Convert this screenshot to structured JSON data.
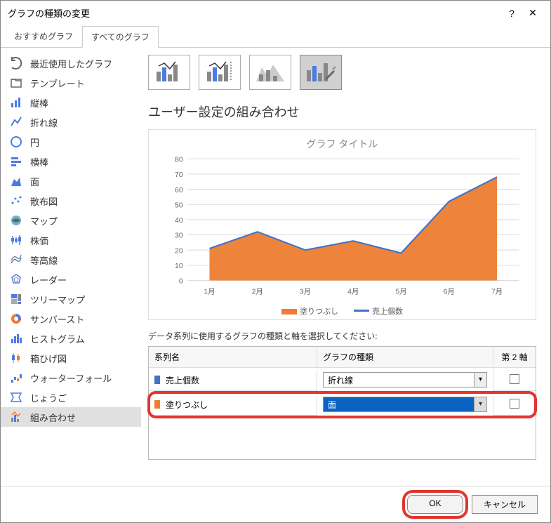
{
  "dialog": {
    "title": "グラフの種類の変更"
  },
  "tabs": {
    "recommended": "おすすめグラフ",
    "all": "すべてのグラフ"
  },
  "sidebar": {
    "items": [
      {
        "label": "最近使用したグラフ"
      },
      {
        "label": "テンプレート"
      },
      {
        "label": "縦棒"
      },
      {
        "label": "折れ線"
      },
      {
        "label": "円"
      },
      {
        "label": "横棒"
      },
      {
        "label": "面"
      },
      {
        "label": "散布図"
      },
      {
        "label": "マップ"
      },
      {
        "label": "株価"
      },
      {
        "label": "等高線"
      },
      {
        "label": "レーダー"
      },
      {
        "label": "ツリーマップ"
      },
      {
        "label": "サンバースト"
      },
      {
        "label": "ヒストグラム"
      },
      {
        "label": "箱ひげ図"
      },
      {
        "label": "ウォーターフォール"
      },
      {
        "label": "じょうご"
      },
      {
        "label": "組み合わせ"
      }
    ],
    "selected_index": 18
  },
  "section_title": "ユーザー設定の組み合わせ",
  "chart_data": {
    "type": "area+line",
    "title": "グラフ タイトル",
    "categories": [
      "1月",
      "2月",
      "3月",
      "4月",
      "5月",
      "6月",
      "7月"
    ],
    "series": [
      {
        "name": "塗りつぶし",
        "type": "area",
        "color": "#ED7D31",
        "values": [
          21,
          32,
          20,
          26,
          18,
          52,
          68
        ]
      },
      {
        "name": "売上個数",
        "type": "line",
        "color": "#4472C4",
        "values": [
          21,
          32,
          20,
          26,
          18,
          52,
          68
        ]
      }
    ],
    "y_ticks": [
      0,
      10,
      20,
      30,
      40,
      50,
      60,
      70,
      80
    ],
    "ylim": [
      0,
      80
    ]
  },
  "legend": {
    "area": "塗りつぶし",
    "line": "売上個数"
  },
  "instruction": "データ系列に使用するグラフの種類と軸を選択してください:",
  "grid": {
    "headers": {
      "name": "系列名",
      "type": "グラフの種類",
      "axis": "第 2 軸"
    },
    "rows": [
      {
        "color": "#4472C4",
        "name": "売上個数",
        "type": "折れ線",
        "axis": false,
        "highlighted": false,
        "selected": false
      },
      {
        "color": "#ED7D31",
        "name": "塗りつぶし",
        "type": "面",
        "axis": false,
        "highlighted": true,
        "selected": true
      }
    ]
  },
  "footer": {
    "ok": "OK",
    "cancel": "キャンセル"
  }
}
